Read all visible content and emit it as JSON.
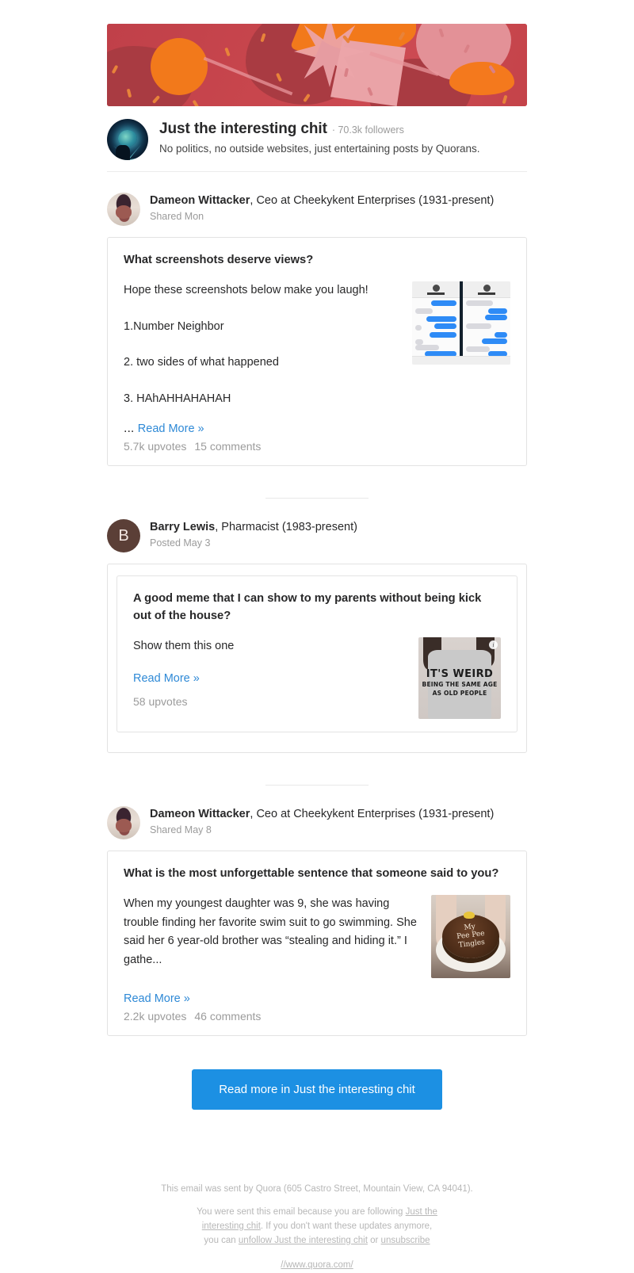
{
  "space": {
    "name": "Just the interesting chit",
    "followers": "· 70.3k followers",
    "description": "No politics, no outside websites, just entertaining posts by Quorans.",
    "avatar_icon": "brain-glow-avatar",
    "banner_icon": "candy-pattern-banner"
  },
  "posts": [
    {
      "author": {
        "name": "Dameon Wittacker",
        "credential": ", Ceo at Cheekykent Enterprises (1931-present)",
        "timestamp": "Shared Mon",
        "avatar_icon": "person-photo-avatar"
      },
      "question": "What screenshots deserve views?",
      "paragraphs": [
        "Hope these screenshots below make you laugh!",
        "1.Number Neighbor",
        "2. two sides of what happened",
        "3. HAhAHHAHAHAH"
      ],
      "ellipsis": "... ",
      "read_more": "Read More »",
      "upvotes": "5.7k upvotes",
      "comments": "15 comments",
      "thumbnail_icon": "imessage-screenshots-thumbnail"
    },
    {
      "author": {
        "name": "Barry Lewis",
        "credential": ", Pharmacist (1983-present)",
        "timestamp": "Posted May 3",
        "avatar_icon": "letter-avatar",
        "avatar_letter": "B"
      },
      "question": "A good meme that I can show to my parents without being kick out of the house?",
      "paragraphs": [
        "Show them this one"
      ],
      "ellipsis": "",
      "read_more": "Read More »",
      "upvotes": "58 upvotes",
      "comments": "",
      "thumbnail_icon": "tshirt-meme-thumbnail",
      "thumbnail_text": {
        "line1": "IT'S WEIRD",
        "line2": "BEING THE SAME AGE",
        "line3": "AS OLD PEOPLE",
        "badge": "i"
      }
    },
    {
      "author": {
        "name": "Dameon Wittacker",
        "credential": ", Ceo at Cheekykent Enterprises (1931-present)",
        "timestamp": "Shared May 8",
        "avatar_icon": "person-photo-avatar"
      },
      "question": "What is the most unforgettable sentence that someone said to you?",
      "paragraphs": [
        "When my youngest daughter was 9, she was having trouble finding her favorite swim suit to go swimming. She said her 6 year-old brother was “stealing and hiding it.” I gathe..."
      ],
      "ellipsis": "",
      "read_more": "Read More »",
      "upvotes": "2.2k upvotes",
      "comments": "46 comments",
      "thumbnail_icon": "chocolate-cake-thumbnail",
      "thumbnail_text": {
        "line1": "My",
        "line2": "Pee Pee",
        "line3": "Tingles"
      }
    }
  ],
  "cta": {
    "label": "Read more in Just the interesting chit"
  },
  "footer": {
    "line1": "This email was sent by Quora (605 Castro Street, Mountain View, CA 94041).",
    "line2_a": "You were sent this email because you are following ",
    "line2_link1": "Just the interesting chit",
    "line2_b": ". If you don't want these updates anymore, you can ",
    "line2_link2": "unfollow Just the interesting chit",
    "line2_c": " or ",
    "line2_link3": "unsubscribe",
    "line3_link": "//www.quora.com/"
  },
  "colors": {
    "link_blue": "#2e89d6",
    "cta_blue": "#1c90e3",
    "banner_red": "#c6434b",
    "banner_orange": "#f2791b",
    "muted_gray": "#9b9b9b"
  }
}
